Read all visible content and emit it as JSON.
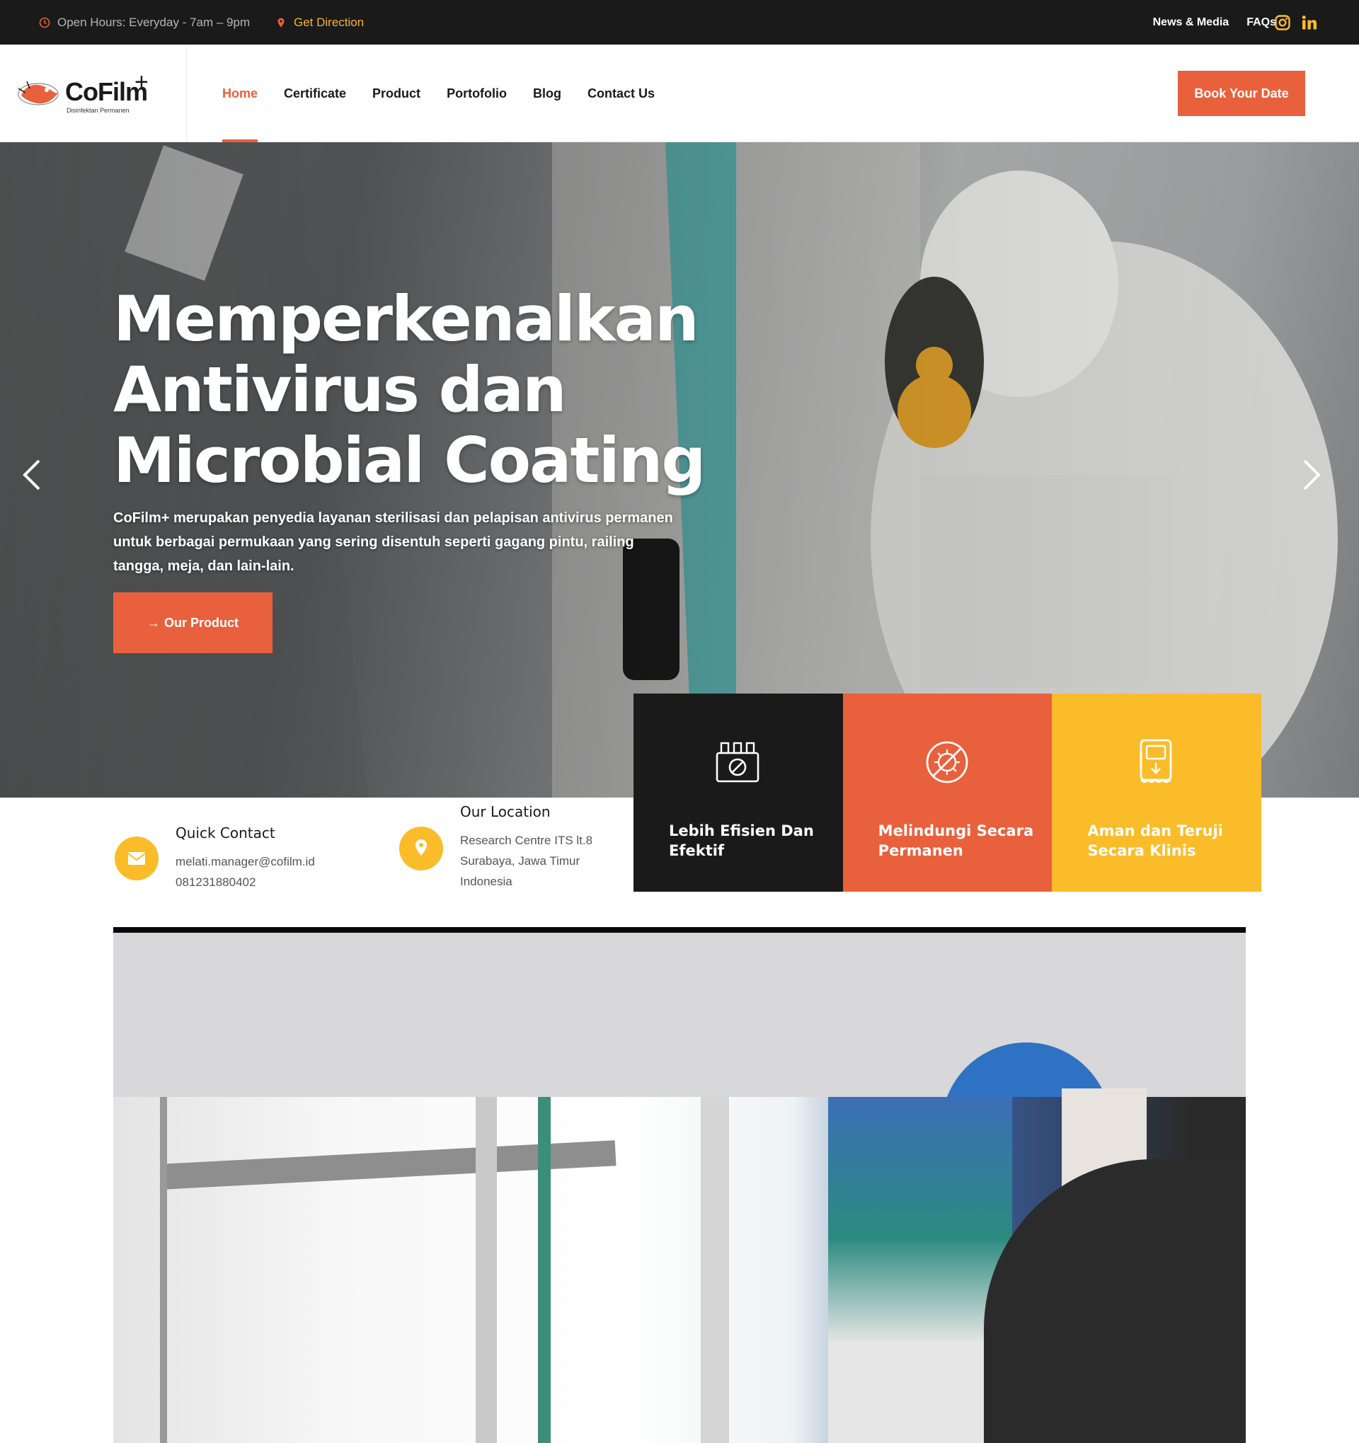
{
  "topbar": {
    "hours": "Open Hours: Everyday - 7am – 9pm",
    "direction": "Get Direction",
    "links": [
      "News & Media",
      "FAQs"
    ],
    "social_icons": [
      "instagram-icon",
      "linkedin-icon"
    ]
  },
  "logo": {
    "name": "CoFilm",
    "plus": "+",
    "tagline": "Disinfektan Permanen"
  },
  "nav": {
    "items": [
      "Home",
      "Certificate",
      "Product",
      "Portofolio",
      "Blog",
      "Contact Us"
    ],
    "active": "Home",
    "cta": "Book Your Date"
  },
  "hero": {
    "title": "Memperkenalkan Antivirus dan Microbial Coating",
    "description": "CoFilm+ merupakan penyedia layanan sterilisasi dan pelapisan antivirus permanen untuk berbagai permukaan yang sering disentuh seperti gagang pintu, railing tangga, meja, dan lain-lain.",
    "button": "Our Product",
    "button_icon": "→"
  },
  "features": [
    {
      "label": "Lebih Efisien Dan Efektif",
      "icon": "sanitizer-bottles-icon"
    },
    {
      "label": "Melindungi Secara Permanen",
      "icon": "virus-blocked-icon"
    },
    {
      "label": "Aman dan Teruji Secara Klinis",
      "icon": "dispenser-icon"
    }
  ],
  "contact": {
    "quick": {
      "title": "Quick Contact",
      "email": "melati.manager@cofilm.id",
      "phone": "081231880402"
    },
    "location": {
      "title": "Our Location",
      "line1": "Research Centre ITS lt.8",
      "line2": "Surabaya, Jawa Timur",
      "line3": "Indonesia"
    }
  },
  "colors": {
    "accent": "#e8603c",
    "yellow": "#fbbc2a",
    "dark": "#1a1a1a"
  }
}
